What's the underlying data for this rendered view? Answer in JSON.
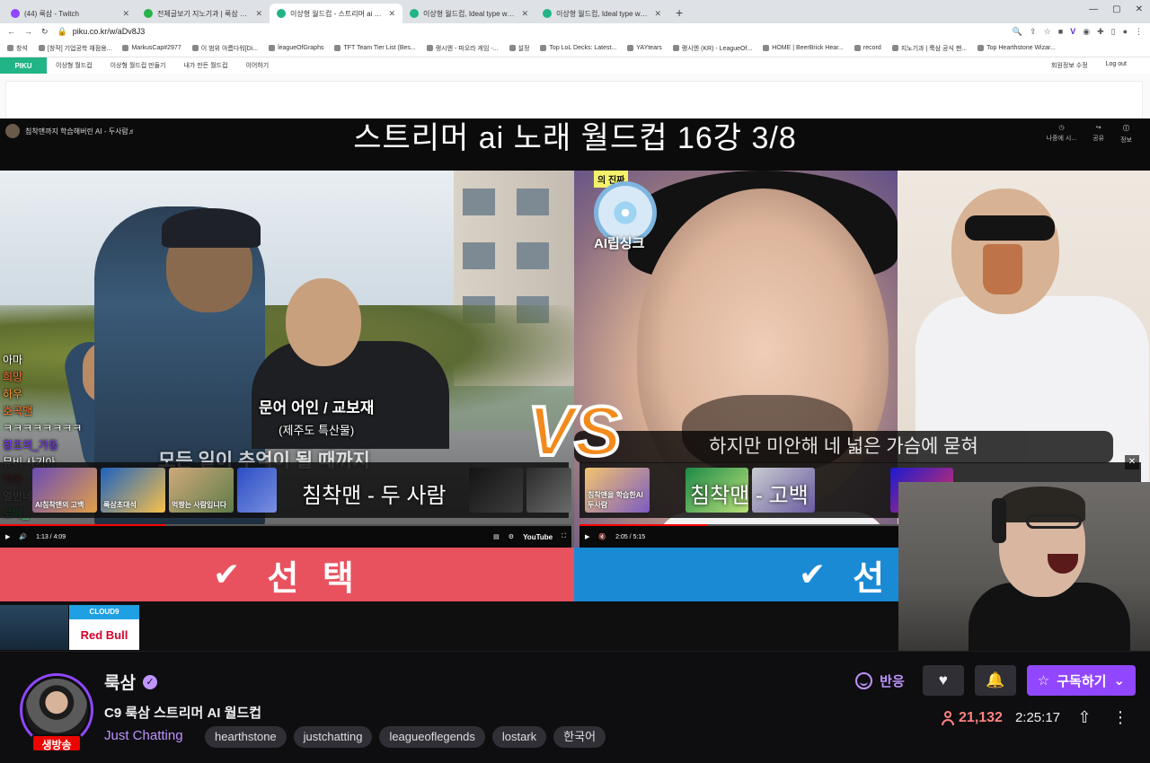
{
  "browser": {
    "tabs": [
      {
        "title": "(44) 룩삼 - Twitch",
        "color": "#9147ff",
        "active": false
      },
      {
        "title": "전체글보기 지노기과 | 룩삼 공식 팬카",
        "color": "#27b24a",
        "active": false
      },
      {
        "title": "이상형 월드컵 - 스트리머 ai 노래",
        "color": "#20b486",
        "active": true
      },
      {
        "title": "이상형 월드컵, Ideal type worldcup Pi",
        "color": "#20b486",
        "active": false
      },
      {
        "title": "이상형 월드컵, Ideal type worldcup Pi",
        "color": "#20b486",
        "active": false
      }
    ],
    "url": "piku.co.kr/w/aDv8J3",
    "bookmarks": [
      "창석",
      "[창작] 기업공학 채점용...",
      "MarkusCap#2977",
      "이 범위 아름다워[Di...",
      "leagueOfGraphs",
      "TFT Team Tier List (Bes...",
      "랭시엔 - 파오라 게임 -...",
      "설정",
      "Top LoL Decks: Latest...",
      "YAYtears",
      "랭시엔 (KR) - LeagueOf...",
      "HOME | BeerBrick Hear...",
      "record",
      "지노기과 | 룩삼 공식 팬...",
      "Top Hearthstone Wizar..."
    ]
  },
  "site": {
    "logo": "PIKU",
    "nav": [
      "이상형 월드컵",
      "이상형 월드컵 만들기",
      "내가 만든 월드컵",
      "이어하기"
    ],
    "nav_right": [
      "회원정보 수정",
      "Log out"
    ],
    "game_title": "스트리머 ai 노래 월드컵   16강   3/8",
    "yt_header_left": "침착맨까지 학습해버린 AI - 두사람♬",
    "yt_header_right": [
      "나중에 시...",
      "공유",
      "정보"
    ],
    "left_video": {
      "caption_name": "문어 어인 / 교보재",
      "caption_sub": "(제주도 특산물)",
      "lyric": "모든 일이 추억이 될 때까지",
      "endcard_title": "침착맨 - 두 사람",
      "thumbs": [
        "AI침착맨의 고백",
        "룩삼초대석",
        "먹짱는 사람입니다"
      ],
      "time": "1:13 / 4:09",
      "progress": 0.29
    },
    "right_video": {
      "tag": "의 진짜",
      "disc_label": "AI립싱크",
      "lyric": "하지만 미안해 네 넓은 가슴에 묻혀",
      "endcard_title": "침착맨 - 고백",
      "thumbs": [
        "침착맨을 학습한AI 두사람"
      ],
      "time": "2:05 / 5:15",
      "progress": 0.4
    },
    "vs": "VS",
    "choice_label": "선 택",
    "check_icon": "✔"
  },
  "chat": [
    {
      "text": "아마",
      "color": "#ffffff"
    },
    {
      "text": "희망",
      "color": "#ff6e3a"
    },
    {
      "text": "하우",
      "color": "#ff9b3a"
    },
    {
      "text": "호곡맨",
      "color": "#ff7a2a"
    },
    {
      "text": "ㅋㅋㅋㅋㅋㅋㅋㅋ",
      "color": "#ffffff"
    },
    {
      "text": "창조의_가동",
      "color": "#7f3aff"
    },
    {
      "text": "뮤비 사기아",
      "color": "#ffffff"
    },
    {
      "text": "이원",
      "color": "#ff3a3a"
    },
    {
      "text": "열반네",
      "color": "#ffffff"
    },
    {
      "text": "로패_",
      "color": "#3aff7a"
    },
    {
      "text": "ㄷㅎ",
      "color": "#ffffff"
    }
  ],
  "sponsors": {
    "c9": "CLOUD9",
    "redbull": "Red Bull"
  },
  "channel": {
    "name": "룩삼",
    "live_label": "생방송",
    "title": "C9 룩삼 스트리머 AI 월드컵",
    "category": "Just Chatting",
    "tags": [
      "hearthstone",
      "justchatting",
      "leagueoflegends",
      "lostark",
      "한국어"
    ],
    "react_label": "반응",
    "subscribe_label": "구독하기",
    "viewers": "21,132",
    "uptime": "2:25:17"
  },
  "colors": {
    "twitch_purple": "#9147ff",
    "live_red": "#eb0400",
    "choice_red": "#e8525f",
    "choice_blue": "#1a8ad4",
    "vs_orange": "#f38a1c"
  }
}
